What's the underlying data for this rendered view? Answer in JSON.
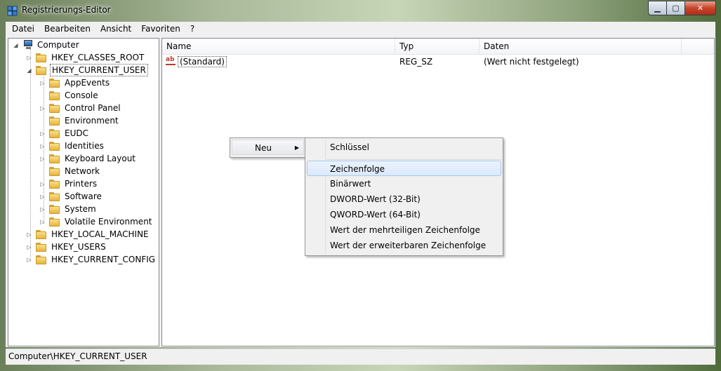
{
  "window": {
    "title": "Registrierungs-Editor"
  },
  "menu": [
    "Datei",
    "Bearbeiten",
    "Ansicht",
    "Favoriten",
    "?"
  ],
  "tree": {
    "root": "Computer",
    "items": [
      {
        "label": "HKEY_CLASSES_ROOT",
        "level": 1,
        "expander": "collapsed"
      },
      {
        "label": "HKEY_CURRENT_USER",
        "level": 1,
        "expander": "expanded",
        "selected": true
      },
      {
        "label": "AppEvents",
        "level": 2,
        "expander": "collapsed"
      },
      {
        "label": "Console",
        "level": 2,
        "expander": "none"
      },
      {
        "label": "Control Panel",
        "level": 2,
        "expander": "collapsed"
      },
      {
        "label": "Environment",
        "level": 2,
        "expander": "none"
      },
      {
        "label": "EUDC",
        "level": 2,
        "expander": "collapsed"
      },
      {
        "label": "Identities",
        "level": 2,
        "expander": "collapsed"
      },
      {
        "label": "Keyboard Layout",
        "level": 2,
        "expander": "collapsed"
      },
      {
        "label": "Network",
        "level": 2,
        "expander": "none"
      },
      {
        "label": "Printers",
        "level": 2,
        "expander": "collapsed"
      },
      {
        "label": "Software",
        "level": 2,
        "expander": "collapsed"
      },
      {
        "label": "System",
        "level": 2,
        "expander": "collapsed"
      },
      {
        "label": "Volatile Environment",
        "level": 2,
        "expander": "collapsed"
      },
      {
        "label": "HKEY_LOCAL_MACHINE",
        "level": 1,
        "expander": "collapsed"
      },
      {
        "label": "HKEY_USERS",
        "level": 1,
        "expander": "collapsed"
      },
      {
        "label": "HKEY_CURRENT_CONFIG",
        "level": 1,
        "expander": "collapsed"
      }
    ]
  },
  "list": {
    "columns": [
      "Name",
      "Typ",
      "Daten"
    ],
    "rows": [
      {
        "name": "(Standard)",
        "type": "REG_SZ",
        "data": "(Wert nicht festgelegt)"
      }
    ]
  },
  "context_menu": {
    "item": "Neu",
    "submenu": [
      "Schlüssel",
      "Zeichenfolge",
      "Binärwert",
      "DWORD-Wert (32-Bit)",
      "QWORD-Wert (64-Bit)",
      "Wert der mehrteiligen Zeichenfolge",
      "Wert der erweiterbaren Zeichenfolge"
    ],
    "highlighted": "Zeichenfolge"
  },
  "status": {
    "path": "Computer\\HKEY_CURRENT_USER"
  }
}
